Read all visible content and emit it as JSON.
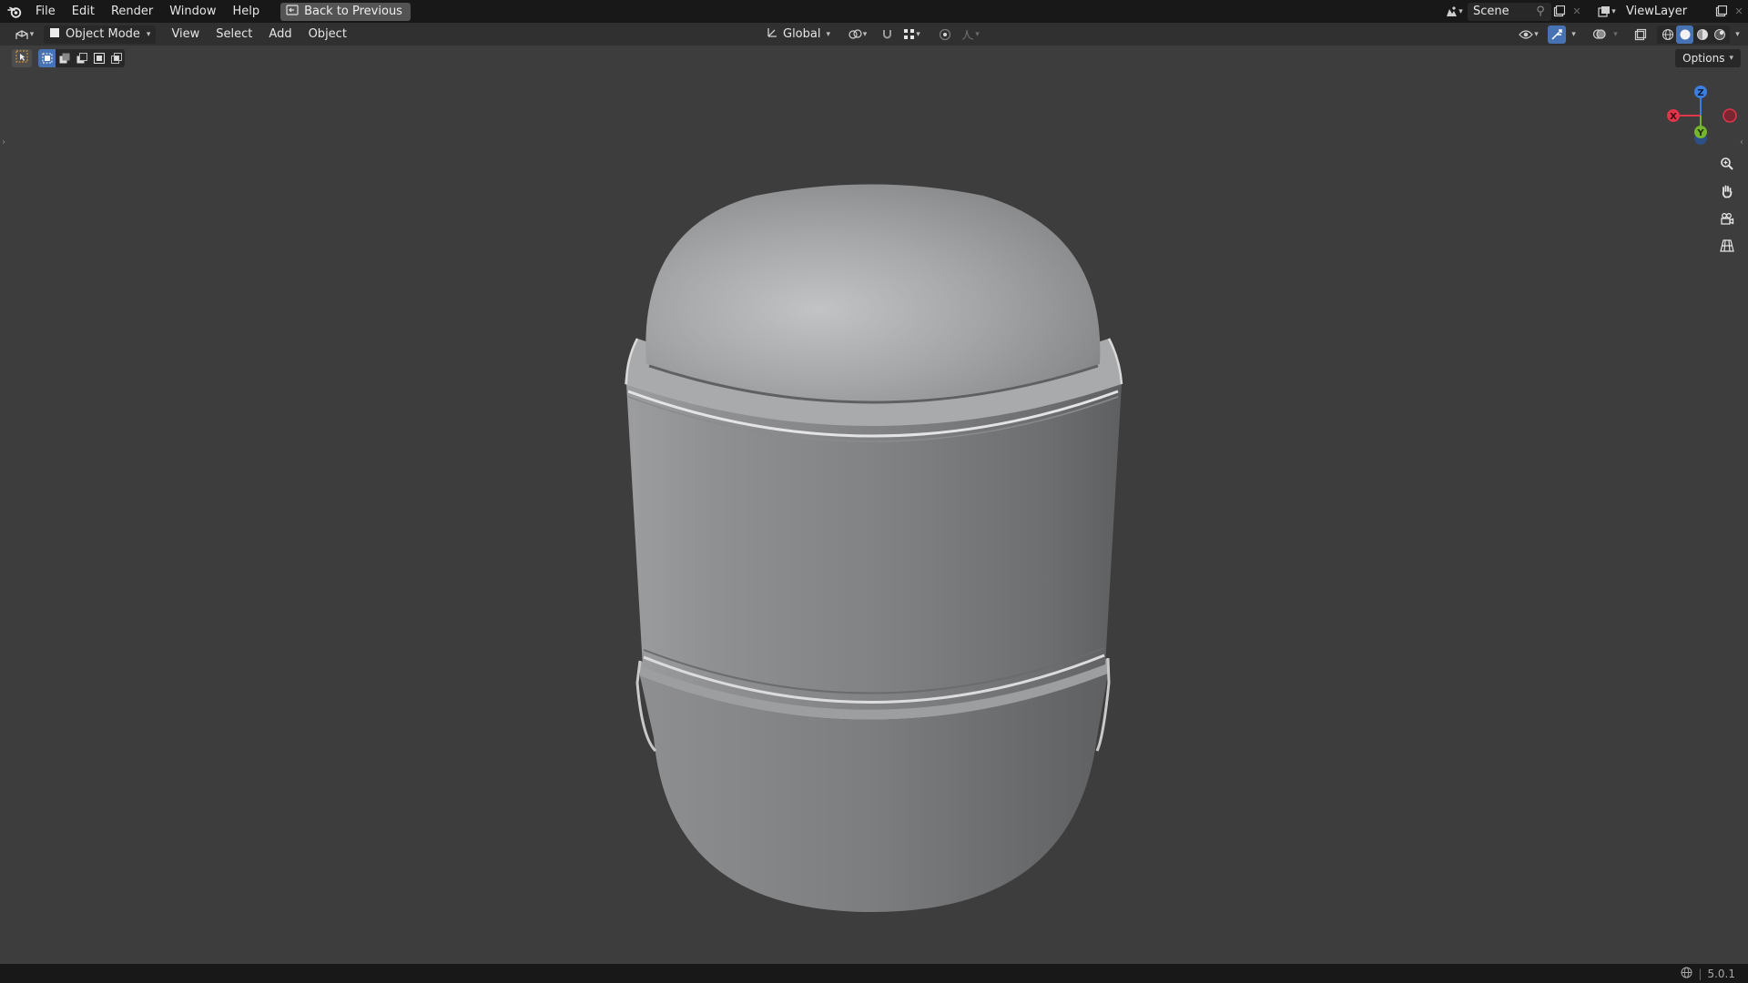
{
  "topbar": {
    "menus": [
      "File",
      "Edit",
      "Render",
      "Window",
      "Help"
    ],
    "back_button": "Back to Previous",
    "scene_name": "Scene",
    "view_layer_name": "ViewLayer"
  },
  "header": {
    "mode": "Object Mode",
    "menus": [
      "View",
      "Select",
      "Add",
      "Object"
    ],
    "transform_orientation": "Global"
  },
  "toolrow": {
    "options_label": "Options"
  },
  "gizmo": {
    "z_label": "Z",
    "x_label": "X",
    "y_label": "Y",
    "colors": {
      "x": "#e0354b",
      "y": "#75b42d",
      "z": "#3a7fdf"
    }
  },
  "icons": [
    "blender-logo",
    "back-icon",
    "scene-icon",
    "pin-icon",
    "new-scene-icon",
    "view-layer-icon",
    "editor-type-icon",
    "object-mode-icon",
    "orientation-icon",
    "pivot-icon",
    "snap-icon",
    "snap-grid-icon",
    "proportional-edit-icon",
    "falloff-icon",
    "visibility-icon",
    "gizmo-icon",
    "overlay-icon",
    "xray-icon",
    "wireframe-shading-icon",
    "solid-shading-icon",
    "material-shading-icon",
    "rendered-shading-icon",
    "select-tool-icon",
    "zoom-icon",
    "hand-pan-icon",
    "camera-icon",
    "perspective-grid-icon",
    "globe-icon"
  ],
  "statusbar": {
    "version": "5.0.1"
  },
  "accent": "#4772b3"
}
